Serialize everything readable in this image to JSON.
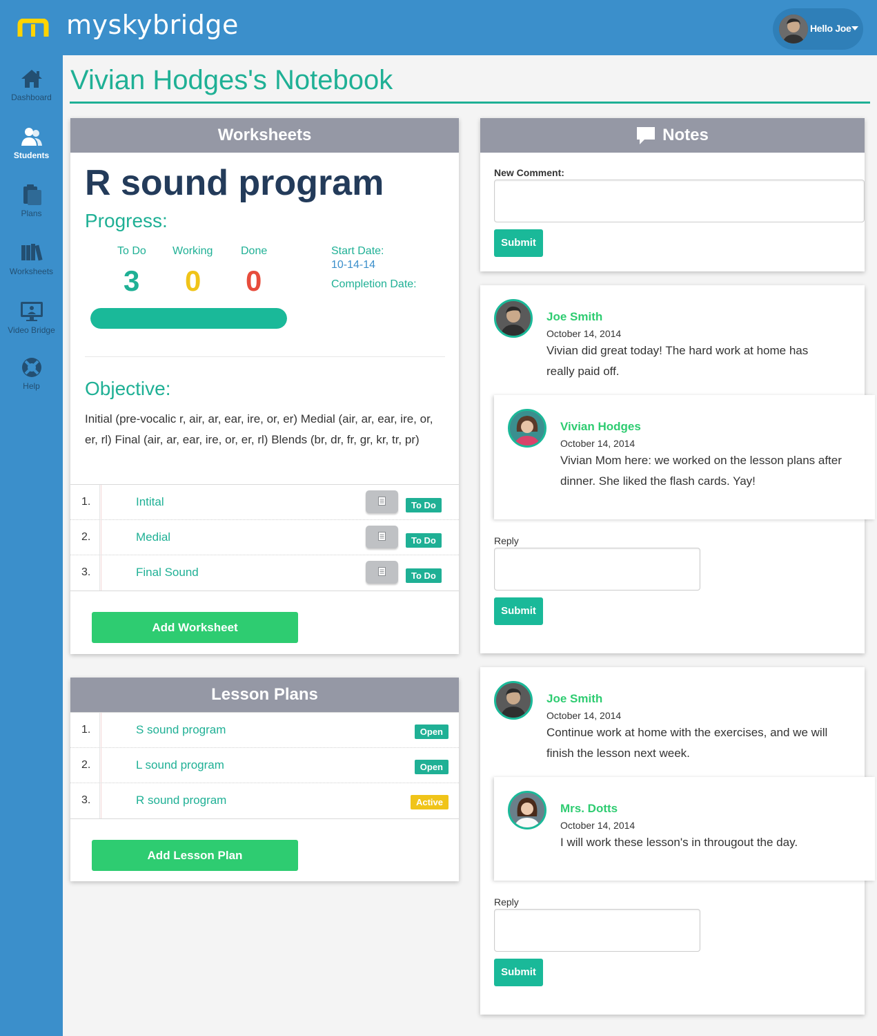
{
  "app": {
    "brand": "myskybridge",
    "user_greeting": "Hello Joe"
  },
  "colors": {
    "accent": "#1fb095",
    "brand_blue": "#3b8fcb",
    "green": "#2ecc71",
    "red": "#e74c3c",
    "yellow": "#f0c419",
    "navy": "#233b5a"
  },
  "sidebar": {
    "items": [
      {
        "label": "Dashboard",
        "icon": "home-icon"
      },
      {
        "label": "Students",
        "icon": "students-icon",
        "active": true
      },
      {
        "label": "Plans",
        "icon": "clipboard-icon"
      },
      {
        "label": "Worksheets",
        "icon": "books-icon"
      },
      {
        "label": "Video Bridge",
        "icon": "monitor-icon"
      },
      {
        "label": "Help",
        "icon": "lifebuoy-icon"
      }
    ]
  },
  "page": {
    "title": "Vivian Hodges's Notebook"
  },
  "worksheets": {
    "heading": "Worksheets",
    "program_title": "R sound program",
    "progress_label": "Progress:",
    "stats": [
      {
        "label": "To Do",
        "value": "3"
      },
      {
        "label": "Working",
        "value": "0"
      },
      {
        "label": "Done",
        "value": "0"
      }
    ],
    "start_date_label": "Start Date:",
    "start_date": "10-14-14",
    "completion_date_label": "Completion Date:",
    "progress_fill": 1.0,
    "objective_label": "Objective:",
    "objective_text": "Initial (pre-vocalic r, air, ar, ear, ire, or, er) Medial (air, ar, ear, ire, or, er, rl) Final (air, ar, ear, ire, or, er, rl) Blends (br, dr, fr, gr, kr, tr, pr)",
    "items": [
      {
        "num": "1.",
        "label": "Intital",
        "status": "To Do"
      },
      {
        "num": "2.",
        "label": "Medial",
        "status": "To Do"
      },
      {
        "num": "3.",
        "label": "Final Sound",
        "status": "To Do"
      }
    ],
    "add_button": "Add Worksheet"
  },
  "lesson_plans": {
    "heading": "Lesson Plans",
    "items": [
      {
        "num": "1.",
        "label": "S sound program",
        "status": "Open"
      },
      {
        "num": "2.",
        "label": "L sound program",
        "status": "Open"
      },
      {
        "num": "3.",
        "label": "R sound program",
        "status": "Active"
      }
    ],
    "add_button": "Add Lesson Plan"
  },
  "notes": {
    "heading": "Notes",
    "new_comment_label": "New Comment:",
    "submit_label": "Submit",
    "reply_label": "Reply",
    "threads": [
      {
        "comment": {
          "author": "Joe Smith",
          "date": "October 14, 2014",
          "text": "Vivian did great today! The hard work at home has really paid off."
        },
        "reply": {
          "author": "Vivian Hodges",
          "date": "October 14, 2014",
          "text": "Vivian Mom here: we worked on the lesson plans after dinner. She liked the flash cards. Yay!"
        }
      },
      {
        "comment": {
          "author": "Joe Smith",
          "date": "October 14, 2014",
          "text": "Continue work at home with the exercises, and we will finish the lesson next week."
        },
        "reply": {
          "author": "Mrs. Dotts",
          "date": "October 14, 2014",
          "text": "I will work these lesson's in througout the day."
        }
      }
    ]
  }
}
